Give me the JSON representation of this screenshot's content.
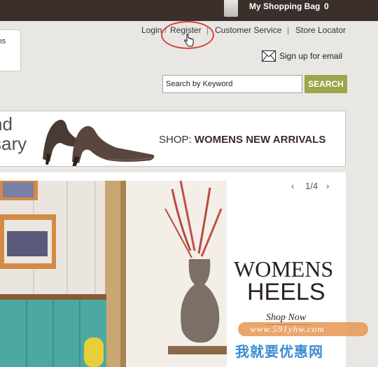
{
  "header": {
    "bag_label": "My Shopping Bag",
    "bag_count": "0"
  },
  "logo": {
    "text": "rns"
  },
  "util_nav": {
    "login": "Login",
    "sep": "/",
    "register": "Register",
    "sep2": "|",
    "customer_service": "Customer Service",
    "sep3": "|",
    "store_locator": "Store Locator"
  },
  "email": {
    "label": "Sign up for email"
  },
  "search": {
    "value": "Search by Keyword",
    "button": "SEARCH"
  },
  "promo": {
    "left_line_1": "nd",
    "left_line_2": "sary",
    "shop_prefix": "SHOP:",
    "shop_title": "WOMENS NEW ARRIVALS"
  },
  "hero": {
    "pager": "1/4",
    "title_1": "WOMENS",
    "title_2": "HEELS",
    "cta": "Shop Now"
  },
  "watermark": {
    "url": "www.591yhw.com",
    "text": "我就要优惠网"
  },
  "colors": {
    "topbar": "#3a2f2a",
    "search_button": "#9ca54a",
    "highlight_circle": "#d9423a"
  }
}
